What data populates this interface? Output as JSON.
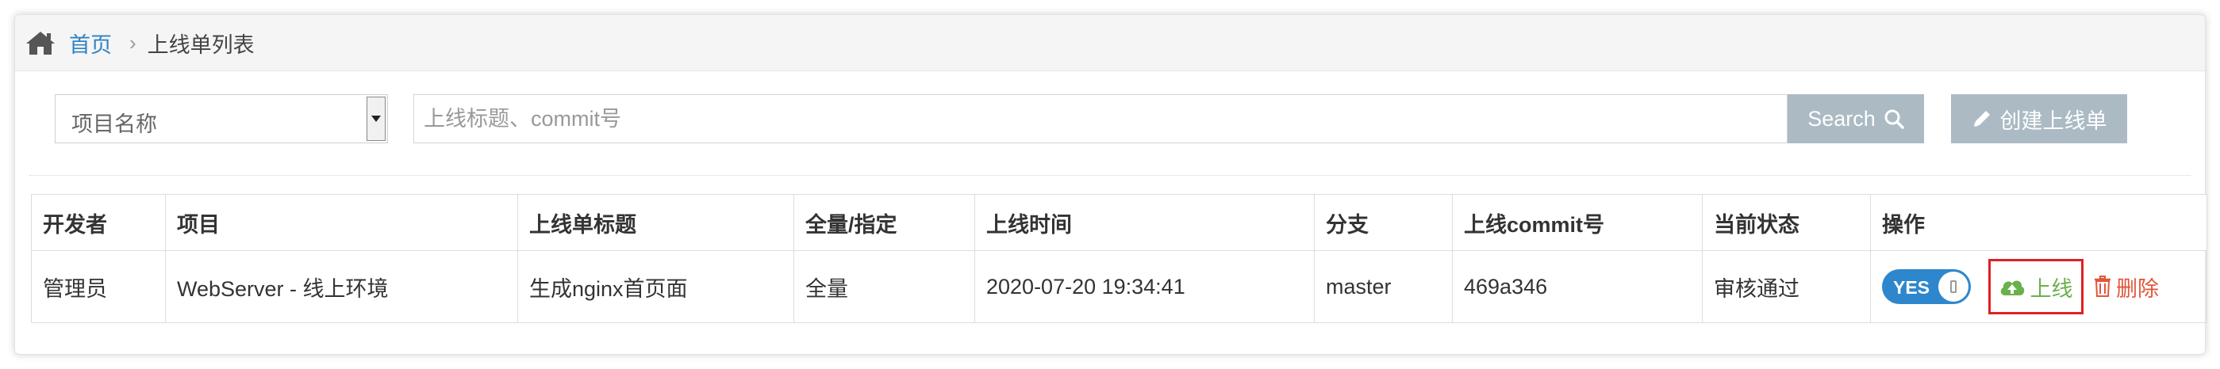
{
  "breadcrumb": {
    "home": "首页",
    "separator": "›",
    "current": "上线单列表"
  },
  "filters": {
    "project_select": "项目名称",
    "search_placeholder": "上线标题、commit号",
    "search_button": "Search",
    "create_button": "创建上线单"
  },
  "table": {
    "headers": [
      "开发者",
      "项目",
      "上线单标题",
      "全量/指定",
      "上线时间",
      "分支",
      "上线commit号",
      "当前状态",
      "操作"
    ],
    "rows": [
      {
        "developer": "管理员",
        "project": "WebServer - 线上环境",
        "title": "生成nginx首页面",
        "scope": "全量",
        "time": "2020-07-20 19:34:41",
        "branch": "master",
        "commit": "469a346",
        "status": "审核通过",
        "actions": {
          "toggle": "YES",
          "online": "上线",
          "delete": "删除"
        }
      }
    ]
  },
  "colors": {
    "link": "#2e83c4",
    "button_gray": "#abbac3",
    "toggle_blue": "#2e87cc",
    "online_green": "#6ab04c",
    "delete_red": "#e0573b",
    "highlight_red": "#e02020"
  },
  "icons": [
    "home-icon",
    "chevron-right-icon",
    "caret-down-icon",
    "search-icon",
    "pencil-icon",
    "cloud-upload-icon",
    "trash-icon"
  ]
}
